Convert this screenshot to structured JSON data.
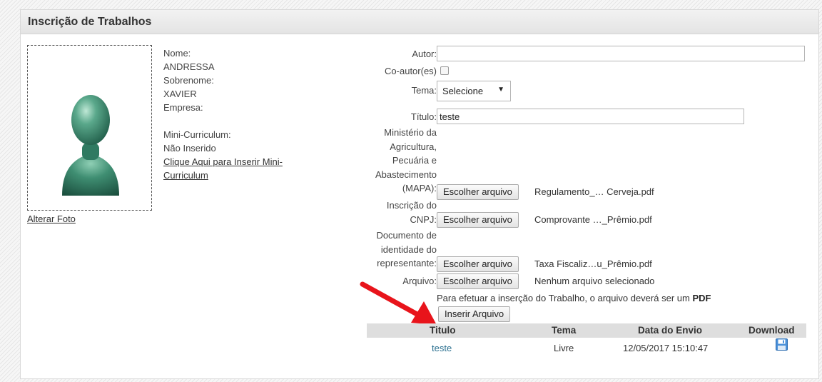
{
  "panel": {
    "title": "Inscrição de Trabalhos"
  },
  "photo": {
    "alter_label": "Alterar Foto"
  },
  "profile": {
    "nome_label": "Nome:",
    "nome_value": "ANDRESSA",
    "sobrenome_label": "Sobrenome:",
    "sobrenome_value": "XAVIER",
    "empresa_label": "Empresa:",
    "empresa_value": "",
    "curriculum_label": "Mini-Curriculum:",
    "curriculum_value": "Não Inserido",
    "curriculum_link_line1": "Clique Aqui para Inserir Mini-",
    "curriculum_link_line2": "Curriculum"
  },
  "form": {
    "autor_label": "Autor:",
    "autor_value": "",
    "coautor_label": "Co-autor(es)",
    "coautor_checked": false,
    "tema_label": "Tema:",
    "tema_selected": "Selecione",
    "titulo_label": "Título:",
    "titulo_value": "teste",
    "mapa_label_lines": [
      "Ministério da",
      "Agricultura,",
      "Pecuária e",
      "Abastecimento",
      "(MAPA):"
    ],
    "mapa_button": "Escolher arquivo",
    "mapa_file": "Regulamento_… Cerveja.pdf",
    "cnpj_label_lines": [
      "Inscrição do",
      "CNPJ:"
    ],
    "cnpj_button": "Escolher arquivo",
    "cnpj_file": "Comprovante …_Prêmio.pdf",
    "doc_label_lines": [
      "Documento de",
      "identidade do",
      "representante:"
    ],
    "doc_button": "Escolher arquivo",
    "doc_file": "Taxa Fiscaliz…u_Prêmio.pdf",
    "arquivo_label": "Arquivo:",
    "arquivo_button": "Escolher arquivo",
    "arquivo_file": "Nenhum arquivo selecionado",
    "note_text": "Para efetuar a inserção do Trabalho, o arquivo deverá ser um ",
    "note_bold": "PDF",
    "insert_button": "Inserir Arquivo"
  },
  "table": {
    "headers": [
      "Titulo",
      "Tema",
      "Data do Envio",
      "Download"
    ],
    "rows": [
      {
        "titulo": "teste",
        "tema": "Livre",
        "data": "12/05/2017 15:10:47"
      }
    ]
  },
  "colors": {
    "arrow": "#e8141b",
    "link": "#2a6f8f",
    "avatar": "#3a8f74"
  },
  "icons": {
    "download": "save-icon",
    "annotation": "red-arrow"
  }
}
